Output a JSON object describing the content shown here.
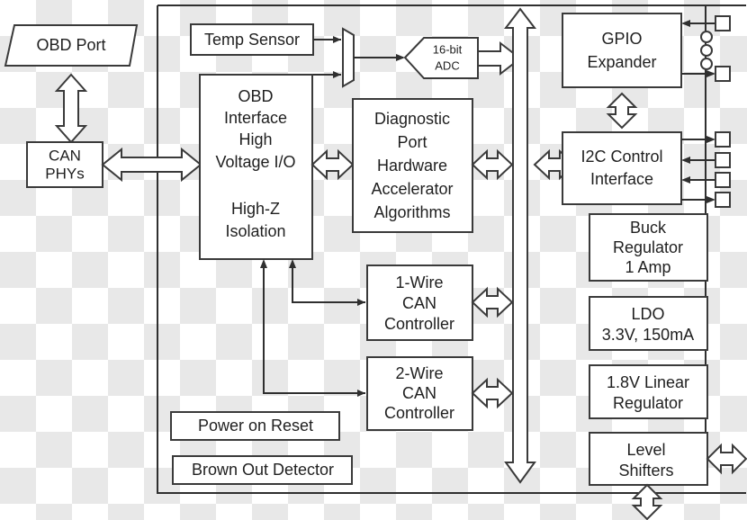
{
  "diagram": {
    "title": "OBD Diagnostic Interface Block Diagram",
    "colors": {
      "line": "#2f2f2f",
      "block_stroke": "#3a3a3a",
      "block_fill": "#ffffff",
      "text": "#1f1f1f",
      "background": "#ffffff",
      "checker": "#e8e8e8"
    },
    "external_blocks": [
      {
        "id": "obd-port",
        "label": "OBD Port",
        "shape": "trapezoid"
      },
      {
        "id": "can-phys",
        "label_line1": "CAN",
        "label_line2": "PHYs",
        "shape": "rect"
      }
    ],
    "chip_blocks": [
      {
        "id": "temp-sensor",
        "label": "Temp Sensor",
        "shape": "rect"
      },
      {
        "id": "analog-mux",
        "label": "",
        "shape": "mux-trapezoid"
      },
      {
        "id": "adc",
        "label_line1": "16-bit",
        "label_line2": "ADC",
        "shape": "hexagon"
      },
      {
        "id": "obd-interface",
        "lines": [
          "OBD",
          "Interface",
          "High",
          "Voltage I/O",
          "",
          "High-Z",
          "Isolation"
        ],
        "shape": "rect"
      },
      {
        "id": "diagnostic-port",
        "lines": [
          "Diagnostic",
          "Port",
          "Hardware",
          "Accelerator",
          "Algorithms"
        ],
        "shape": "rect"
      },
      {
        "id": "one-wire-can",
        "lines": [
          "1-Wire",
          "CAN",
          "Controller"
        ],
        "shape": "rect"
      },
      {
        "id": "two-wire-can",
        "lines": [
          "2-Wire",
          "CAN",
          "Controller"
        ],
        "shape": "rect"
      },
      {
        "id": "power-on-reset",
        "label": "Power on Reset",
        "shape": "rect"
      },
      {
        "id": "brown-out-detector",
        "label": "Brown Out Detector",
        "shape": "rect"
      },
      {
        "id": "gpio-expander",
        "lines": [
          "GPIO",
          "Expander"
        ],
        "shape": "rect"
      },
      {
        "id": "i2c-control",
        "lines": [
          "I2C Control",
          "Interface"
        ],
        "shape": "rect"
      },
      {
        "id": "buck-regulator",
        "lines": [
          "Buck",
          "Regulator",
          "1 Amp"
        ],
        "shape": "rect"
      },
      {
        "id": "ldo",
        "lines": [
          "LDO",
          "3.3V, 150mA"
        ],
        "shape": "rect"
      },
      {
        "id": "linear-regulator",
        "lines": [
          "1.8V Linear",
          "Regulator"
        ],
        "shape": "rect"
      },
      {
        "id": "level-shifters",
        "lines": [
          "Level",
          "Shifters"
        ],
        "shape": "rect"
      }
    ],
    "labels": {
      "obd_port": "OBD Port",
      "can_phys_1": "CAN",
      "can_phys_2": "PHYs",
      "temp_sensor": "Temp Sensor",
      "adc_1": "16-bit",
      "adc_2": "ADC",
      "obd_if_1": "OBD",
      "obd_if_2": "Interface",
      "obd_if_3": "High",
      "obd_if_4": "Voltage I/O",
      "obd_if_5": "High-Z",
      "obd_if_6": "Isolation",
      "diag_1": "Diagnostic",
      "diag_2": "Port",
      "diag_3": "Hardware",
      "diag_4": "Accelerator",
      "diag_5": "Algorithms",
      "one_wire_1": "1-Wire",
      "one_wire_2": "CAN",
      "one_wire_3": "Controller",
      "two_wire_1": "2-Wire",
      "two_wire_2": "CAN",
      "two_wire_3": "Controller",
      "power_on_reset": "Power on Reset",
      "brown_out_detector": "Brown Out Detector",
      "gpio_1": "GPIO",
      "gpio_2": "Expander",
      "i2c_1": "I2C Control",
      "i2c_2": "Interface",
      "buck_1": "Buck",
      "buck_2": "Regulator",
      "buck_3": "1 Amp",
      "ldo_1": "LDO",
      "ldo_2": "3.3V, 150mA",
      "lin_1": "1.8V Linear",
      "lin_2": "Regulator",
      "level_1": "Level",
      "level_2": "Shifters"
    },
    "connections": [
      {
        "id": "obd-port-to-can-phys",
        "type": "double-block-arrow",
        "orientation": "vertical"
      },
      {
        "id": "can-phys-to-obd-interface",
        "type": "double-block-arrow",
        "orientation": "horizontal"
      },
      {
        "id": "temp-sensor-to-mux",
        "type": "line-arrow",
        "orientation": "horizontal"
      },
      {
        "id": "obd-interface-to-mux",
        "type": "line-arrow",
        "orientation": "horizontal"
      },
      {
        "id": "mux-to-adc",
        "type": "line-arrow",
        "orientation": "horizontal"
      },
      {
        "id": "adc-to-bus",
        "type": "block-arrow",
        "orientation": "horizontal"
      },
      {
        "id": "obd-interface-to-diagnostic-port",
        "type": "double-block-arrow",
        "orientation": "horizontal"
      },
      {
        "id": "diagnostic-port-to-bus",
        "type": "double-block-arrow",
        "orientation": "horizontal"
      },
      {
        "id": "bus-to-i2c-control",
        "type": "double-block-arrow",
        "orientation": "horizontal"
      },
      {
        "id": "gpio-to-i2c",
        "type": "double-block-arrow",
        "orientation": "vertical"
      },
      {
        "id": "one-wire-to-bus",
        "type": "double-block-arrow",
        "orientation": "horizontal"
      },
      {
        "id": "two-wire-to-bus",
        "type": "double-block-arrow",
        "orientation": "horizontal"
      },
      {
        "id": "obd-interface-to-one-wire",
        "type": "line-arrow",
        "orientation": "elbow"
      },
      {
        "id": "obd-interface-to-two-wire",
        "type": "line-arrow",
        "orientation": "elbow"
      },
      {
        "id": "level-shifters-right",
        "type": "double-block-arrow",
        "orientation": "horizontal"
      },
      {
        "id": "level-shifters-down",
        "type": "double-block-arrow",
        "orientation": "vertical"
      },
      {
        "id": "internal-bus",
        "type": "double-block-arrow",
        "orientation": "vertical"
      }
    ],
    "pins": {
      "count": 6,
      "shape": "square-pad",
      "ellipsis_dots": 3
    }
  }
}
